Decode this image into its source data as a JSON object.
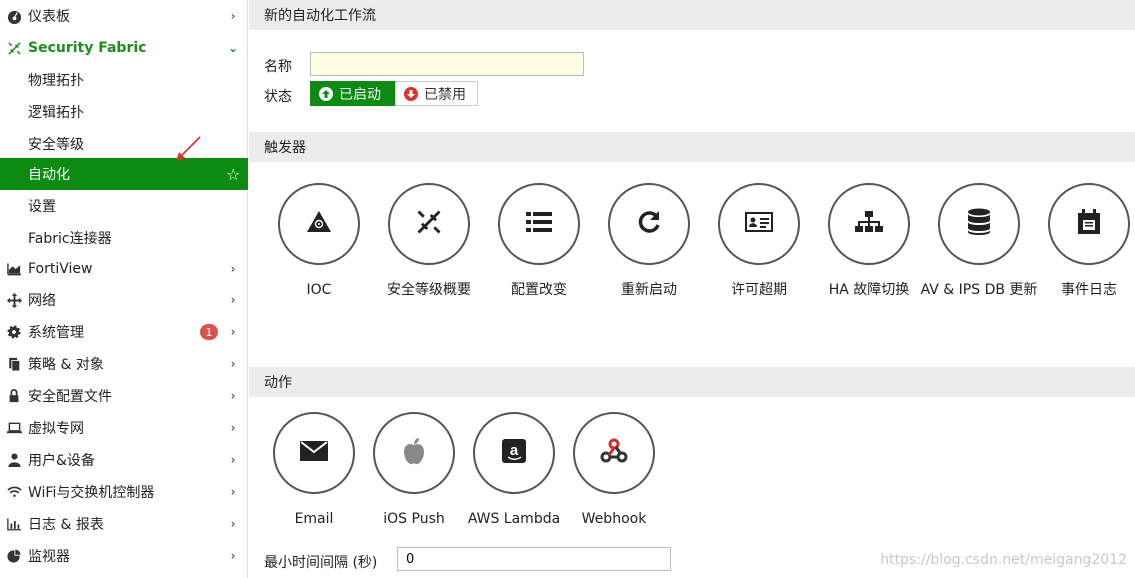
{
  "sidebar": {
    "items": [
      {
        "label": "仪表板"
      },
      {
        "label": "Security Fabric"
      },
      {
        "label": "物理拓扑"
      },
      {
        "label": "逻辑拓扑"
      },
      {
        "label": "安全等级"
      },
      {
        "label": "自动化"
      },
      {
        "label": "设置"
      },
      {
        "label": "Fabric连接器"
      },
      {
        "label": "FortiView"
      },
      {
        "label": "网络"
      },
      {
        "label": "系统管理",
        "badge": "1"
      },
      {
        "label": "策略 & 对象"
      },
      {
        "label": "安全配置文件"
      },
      {
        "label": "虚拟专网"
      },
      {
        "label": "用户&设备"
      },
      {
        "label": "WiFi与交换机控制器"
      },
      {
        "label": "日志 & 报表"
      },
      {
        "label": "监视器"
      }
    ]
  },
  "main": {
    "title": "新的自动化工作流",
    "name_label": "名称",
    "name_value": "",
    "status_label": "状态",
    "status_enabled": "已启动",
    "status_disabled": "已禁用",
    "triggers_header": "触发器",
    "triggers": [
      {
        "label": "IOC",
        "icon": "biohazard-icon"
      },
      {
        "label": "安全等级概要",
        "icon": "security-rating-icon"
      },
      {
        "label": "配置改变",
        "icon": "list-icon"
      },
      {
        "label": "重新启动",
        "icon": "refresh-icon"
      },
      {
        "label": "许可超期",
        "icon": "id-card-icon"
      },
      {
        "label": "HA 故障切换",
        "icon": "sitemap-icon"
      },
      {
        "label": "AV & IPS DB 更新",
        "icon": "database-icon"
      },
      {
        "label": "事件日志",
        "icon": "calendar-icon"
      }
    ],
    "actions_header": "动作",
    "actions": [
      {
        "label": "Email",
        "icon": "envelope-icon"
      },
      {
        "label": "iOS Push",
        "icon": "apple-icon"
      },
      {
        "label": "AWS Lambda",
        "icon": "amazon-icon"
      },
      {
        "label": "Webhook",
        "icon": "webhook-icon"
      }
    ],
    "interval_label": "最小时间间隔 (秒)",
    "interval_value": "0"
  },
  "watermark": "https://blog.csdn.net/meigang2012",
  "colors": {
    "accent": "#0d8a12",
    "open_text": "#1e8d1e",
    "danger": "#d9342b",
    "header_bg": "#ececec"
  }
}
